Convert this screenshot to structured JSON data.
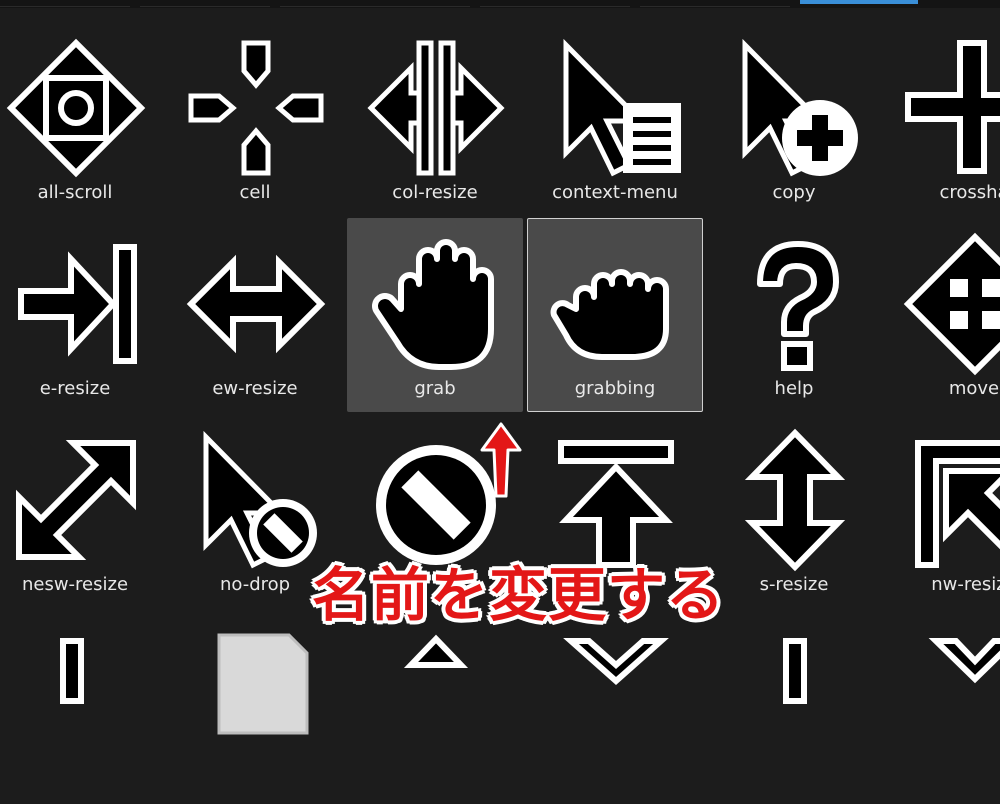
{
  "cursors": [
    {
      "label": "all-scroll",
      "icon": "all-scroll-icon"
    },
    {
      "label": "cell",
      "icon": "cell-icon"
    },
    {
      "label": "col-resize",
      "icon": "col-resize-icon"
    },
    {
      "label": "context-menu",
      "icon": "context-menu-icon"
    },
    {
      "label": "copy",
      "icon": "copy-icon"
    },
    {
      "label": "crossha",
      "icon": "crosshair-icon"
    },
    {
      "label": "e-resize",
      "icon": "e-resize-icon"
    },
    {
      "label": "ew-resize",
      "icon": "ew-resize-icon"
    },
    {
      "label": "grab",
      "icon": "grab-icon",
      "state": "hover"
    },
    {
      "label": "grabbing",
      "icon": "grabbing-icon",
      "state": "selected"
    },
    {
      "label": "help",
      "icon": "help-icon"
    },
    {
      "label": "move",
      "icon": "move-icon"
    },
    {
      "label": "nesw-resize",
      "icon": "nesw-resize-icon"
    },
    {
      "label": "no-drop",
      "icon": "no-drop-icon"
    },
    {
      "label": "",
      "icon": "not-allowed-icon"
    },
    {
      "label": "",
      "icon": "n-resize-icon"
    },
    {
      "label": "s-resize",
      "icon": "ns-resize-icon"
    },
    {
      "label": "nw-resize",
      "icon": "nw-resize-icon"
    }
  ],
  "annotation": {
    "text": "名前を変更する",
    "color": "#e31717"
  },
  "colors": {
    "background": "#1c1c1c",
    "tile_highlight": "#4a4a4a",
    "accent": "#3a8fd8"
  }
}
